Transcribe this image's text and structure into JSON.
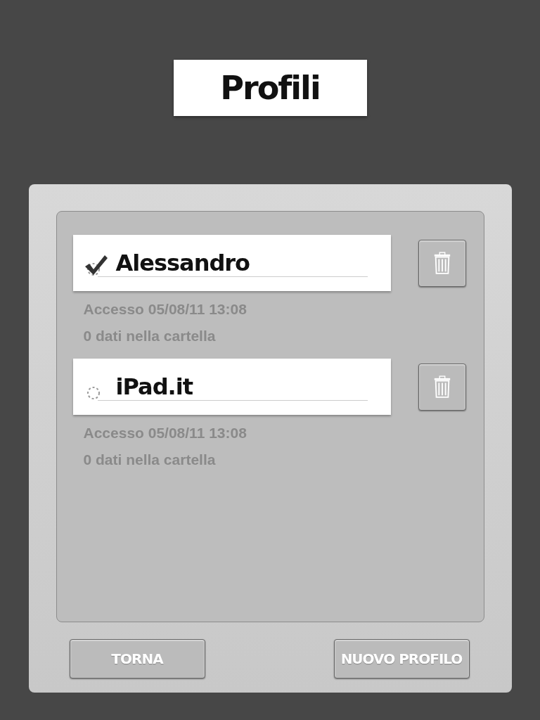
{
  "title": "Profili",
  "profiles": [
    {
      "name": "Alessandro",
      "selected": true,
      "access": "Accesso 05/08/11 13:08",
      "info": "0 dati nella cartella"
    },
    {
      "name": "iPad.it",
      "selected": false,
      "access": "Accesso 05/08/11 13:08",
      "info": "0 dati nella cartella"
    }
  ],
  "buttons": {
    "back": "TORNA",
    "new": "NUOVO PROFILO"
  }
}
